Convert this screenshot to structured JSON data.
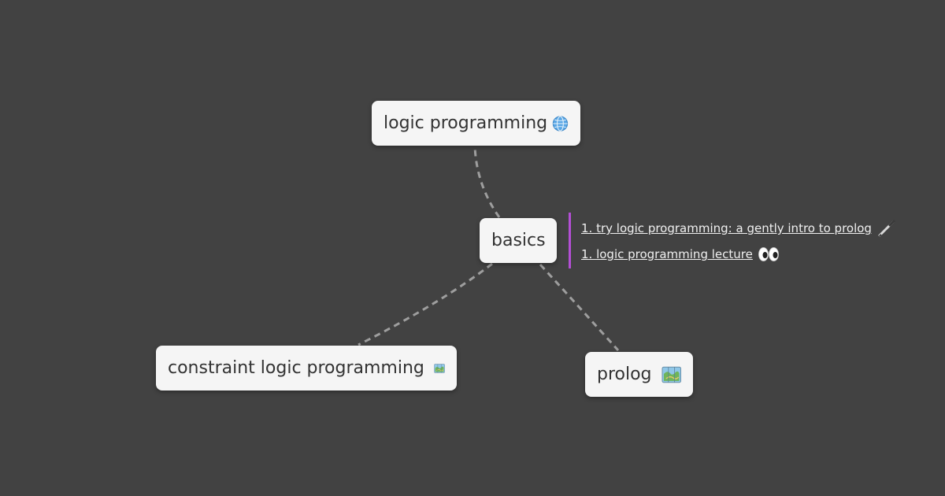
{
  "mindmap": {
    "root": {
      "label": "basics"
    },
    "nodes": [
      {
        "label": "logic programming",
        "icon": "globe-icon"
      },
      {
        "label": "constraint logic programming",
        "icon": "map-icon"
      },
      {
        "label": "prolog",
        "icon": "map-icon"
      }
    ],
    "notes": [
      {
        "text": "1. try logic programming: a gently intro to prolog",
        "icon": "pen-icon"
      },
      {
        "text": "1. logic programming lecture",
        "icon": "eyes-icon"
      }
    ]
  },
  "colors": {
    "background": "#424242",
    "node_fill": "#f5f5f5",
    "node_text": "#333333",
    "connector": "#9e9e9e",
    "note_accent": "#b44fd6",
    "note_text": "#f0f0f0"
  }
}
